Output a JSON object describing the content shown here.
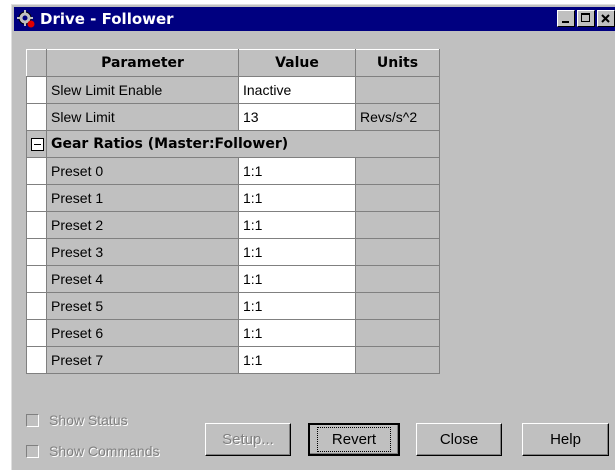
{
  "window": {
    "title": "Drive - Follower"
  },
  "grid": {
    "headers": {
      "parameter": "Parameter",
      "value": "Value",
      "units": "Units"
    },
    "rows": [
      {
        "parameter": "Slew Limit Enable",
        "value": "Inactive",
        "units": ""
      },
      {
        "parameter": "Slew Limit",
        "value": "13",
        "units": "Revs/s^2"
      }
    ],
    "group": {
      "label": "Gear Ratios (Master:Follower)",
      "rows": [
        {
          "parameter": "Preset 0",
          "value": "1:1"
        },
        {
          "parameter": "Preset 1",
          "value": "1:1"
        },
        {
          "parameter": "Preset 2",
          "value": "1:1"
        },
        {
          "parameter": "Preset 3",
          "value": "1:1"
        },
        {
          "parameter": "Preset 4",
          "value": "1:1"
        },
        {
          "parameter": "Preset 5",
          "value": "1:1"
        },
        {
          "parameter": "Preset 6",
          "value": "1:1"
        },
        {
          "parameter": "Preset 7",
          "value": "1:1"
        }
      ]
    }
  },
  "options": {
    "show_status": {
      "label": "Show Status",
      "checked": false,
      "enabled": false
    },
    "show_commands": {
      "label": "Show Commands",
      "checked": false,
      "enabled": false
    }
  },
  "buttons": {
    "setup": "Setup...",
    "revert": "Revert",
    "close": "Close",
    "help": "Help"
  },
  "colors": {
    "titlebar": "#000080",
    "face": "#c0c0c0",
    "disabled_text": "#808080"
  }
}
